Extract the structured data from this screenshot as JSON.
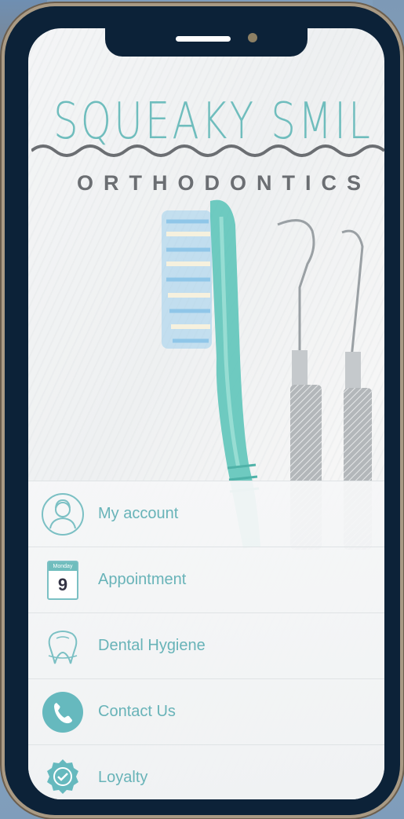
{
  "brand": {
    "title": "SQUEAKY SMIL",
    "subtitle": "ORTHODONTICS"
  },
  "colors": {
    "accent": "#6fbdbd",
    "frame": "#0c2238",
    "text_gray": "#6b6e72"
  },
  "menu": [
    {
      "label": "My account",
      "icon": "user-profile-icon"
    },
    {
      "label": "Appointment",
      "icon": "calendar-icon",
      "calendar_day": "Monday",
      "calendar_date": "9"
    },
    {
      "label": "Dental Hygiene",
      "icon": "tooth-icon"
    },
    {
      "label": "Contact Us",
      "icon": "phone-icon"
    },
    {
      "label": "Loyalty",
      "icon": "loyalty-badge-icon"
    }
  ]
}
